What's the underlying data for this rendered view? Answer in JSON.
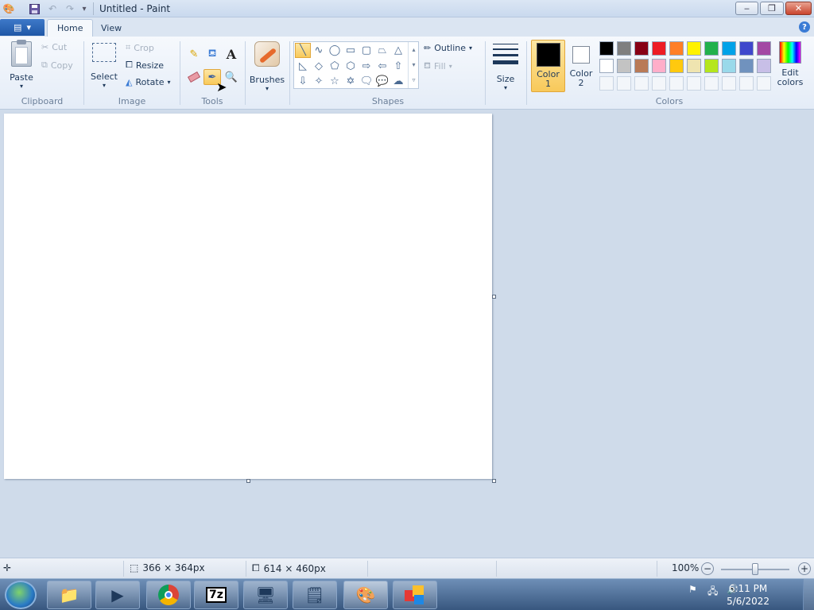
{
  "window": {
    "title": "Untitled - Paint",
    "min": "‒",
    "max": "❐",
    "close": "✕"
  },
  "quick_access": {
    "save_icon": "save-icon",
    "undo_icon": "undo-icon",
    "redo_icon": "redo-icon",
    "customize": "▾"
  },
  "tabs": {
    "app_menu_arrow": "▾",
    "home": "Home",
    "view": "View",
    "help": "?"
  },
  "clipboard": {
    "paste": "Paste",
    "cut": "Cut",
    "copy": "Copy",
    "label": "Clipboard"
  },
  "image": {
    "select": "Select",
    "crop": "Crop",
    "resize": "Resize",
    "rotate": "Rotate",
    "label": "Image"
  },
  "tools": {
    "label": "Tools",
    "text_tool": "A"
  },
  "brushes": {
    "label": "Brushes"
  },
  "shapes": {
    "label": "Shapes",
    "outline": "Outline",
    "fill": "Fill"
  },
  "size": {
    "label": "Size"
  },
  "colors": {
    "color1_l1": "Color",
    "color1_l2": "1",
    "color2_l1": "Color",
    "color2_l2": "2",
    "edit_l1": "Edit",
    "edit_l2": "colors",
    "label": "Colors",
    "color1_value": "#000000",
    "color2_value": "#ffffff",
    "row1": [
      "#000000",
      "#7f7f7f",
      "#880015",
      "#ed1c24",
      "#ff7f27",
      "#fff200",
      "#22b14c",
      "#00a2e8",
      "#3f48cc",
      "#a349a4"
    ],
    "row2": [
      "#ffffff",
      "#c3c3c3",
      "#b97a57",
      "#ffaec9",
      "#ffc90e",
      "#efe4b0",
      "#b5e61d",
      "#99d9ea",
      "#7092be",
      "#c8bfe7"
    ]
  },
  "status": {
    "selection_size": "366 × 364px",
    "canvas_size": "614 × 460px",
    "zoom": "100%"
  },
  "taskbar": {
    "clock_time": "6:11 PM",
    "clock_date": "5/6/2022",
    "sevenzip": "7z"
  }
}
